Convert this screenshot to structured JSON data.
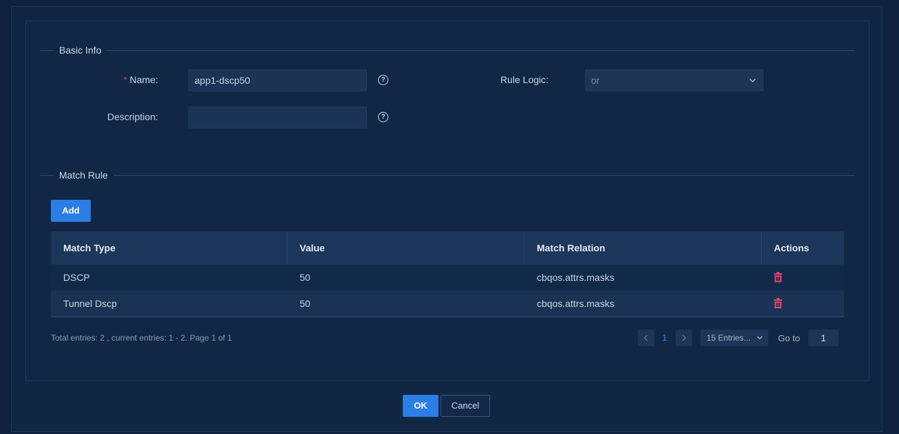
{
  "sections": {
    "basic_info": "Basic Info",
    "match_rule": "Match Rule"
  },
  "form": {
    "name_label": "Name:",
    "name_value": "app1-dscp50",
    "description_label": "Description:",
    "description_value": "",
    "rule_logic_label": "Rule Logic:",
    "rule_logic_value": "or",
    "help_glyph": "?"
  },
  "add_button": "Add",
  "table": {
    "columns": [
      "Match Type",
      "Value",
      "Match Relation",
      "Actions"
    ],
    "rows": [
      {
        "match_type": "DSCP",
        "value": "50",
        "match_relation": "cbqos.attrs.masks"
      },
      {
        "match_type": "Tunnel Dscp",
        "value": "50",
        "match_relation": "cbqos.attrs.masks"
      }
    ]
  },
  "pagination": {
    "summary": "Total entries: 2 , current entries: 1 - 2. Page 1 of 1",
    "current_page": "1",
    "page_size": "15 Entries...",
    "goto_label": "Go to",
    "goto_value": "1",
    "prev_icon": "chevron-left-icon",
    "next_icon": "chevron-right-icon"
  },
  "dialog": {
    "ok_label": "OK",
    "cancel_label": "Cancel"
  },
  "colors": {
    "primary": "#2a7ee6",
    "danger": "#e0446d",
    "background": "#102744"
  }
}
